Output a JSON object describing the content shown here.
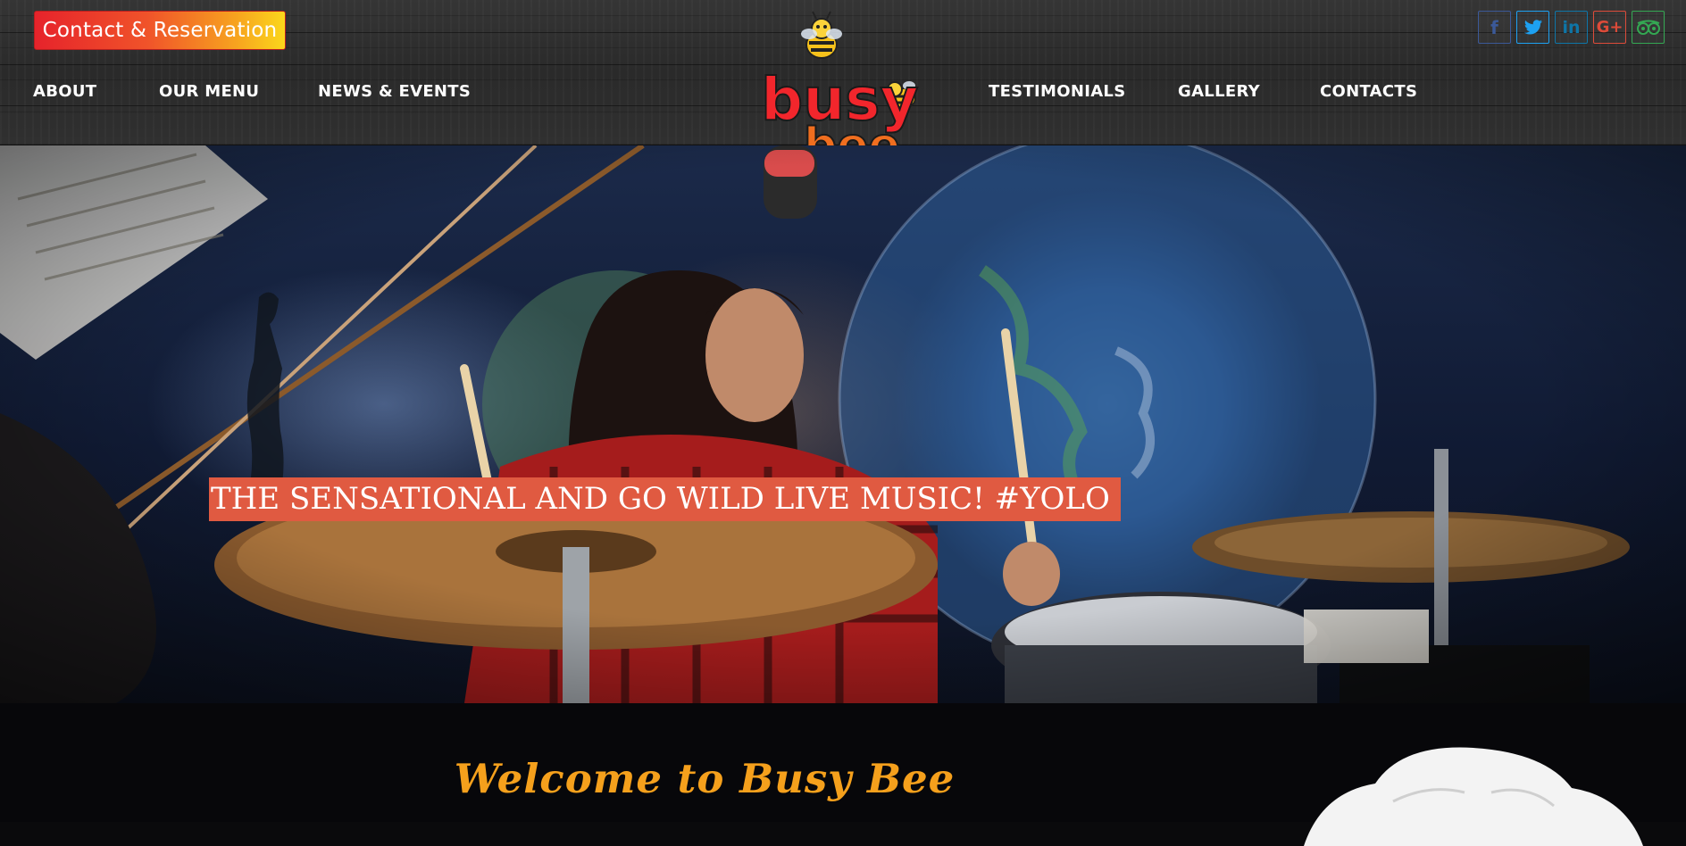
{
  "header": {
    "reserve_button": "Contact & Reservation",
    "nav_left": [
      "ABOUT",
      "OUR MENU",
      "NEWS & EVENTS"
    ],
    "nav_right": [
      "TESTIMONIALS",
      "GALLERY",
      "CONTACTS"
    ],
    "logo": {
      "line1": "busy",
      "line2": "bee"
    },
    "social": [
      {
        "name": "facebook-icon",
        "glyph": "f",
        "color": "#3b5998"
      },
      {
        "name": "twitter-icon",
        "glyph": "t",
        "color": "#1da1f2"
      },
      {
        "name": "linkedin-icon",
        "glyph": "in",
        "color": "#0e76a8"
      },
      {
        "name": "google-plus-icon",
        "glyph": "G+",
        "color": "#dd4b39"
      },
      {
        "name": "tripadvisor-icon",
        "glyph": "◎◎",
        "color": "#34a853"
      }
    ]
  },
  "hero": {
    "caption": "THE SENSATIONAL AND GO WILD LIVE MUSIC! #YOLO"
  },
  "welcome": {
    "title": "Welcome to Busy Bee"
  },
  "colors": {
    "accent": "#f5a01c",
    "caption_bg": "#e05a41",
    "header_bg": "#2e2e2e"
  }
}
